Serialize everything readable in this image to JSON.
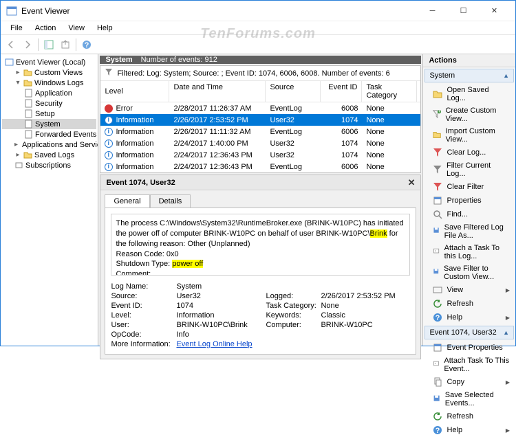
{
  "window": {
    "title": "Event Viewer"
  },
  "menu": [
    "File",
    "Action",
    "View",
    "Help"
  ],
  "watermark": "TenForums.com",
  "tree": {
    "root": "Event Viewer (Local)",
    "custom": "Custom Views",
    "winlogs": "Windows Logs",
    "winlogs_items": [
      "Application",
      "Security",
      "Setup",
      "System",
      "Forwarded Events"
    ],
    "appsvc": "Applications and Services Logs",
    "saved": "Saved Logs",
    "subs": "Subscriptions"
  },
  "midheader": {
    "title": "System",
    "count_label": "Number of events: 912"
  },
  "filterbar": "Filtered: Log: System; Source: ; Event ID: 1074, 6006, 6008. Number of events: 6",
  "columns": {
    "level": "Level",
    "dt": "Date and Time",
    "src": "Source",
    "eid": "Event ID",
    "tc": "Task Category"
  },
  "rows": [
    {
      "lvl": "Error",
      "lvlclass": "lvl-err",
      "dt": "2/28/2017 11:26:37 AM",
      "src": "EventLog",
      "eid": "6008",
      "tc": "None",
      "sel": false
    },
    {
      "lvl": "Information",
      "lvlclass": "lvl-info",
      "dt": "2/26/2017 2:53:52 PM",
      "src": "User32",
      "eid": "1074",
      "tc": "None",
      "sel": true
    },
    {
      "lvl": "Information",
      "lvlclass": "lvl-info",
      "dt": "2/26/2017 11:11:32 AM",
      "src": "EventLog",
      "eid": "6006",
      "tc": "None",
      "sel": false
    },
    {
      "lvl": "Information",
      "lvlclass": "lvl-info",
      "dt": "2/24/2017 1:40:00 PM",
      "src": "User32",
      "eid": "1074",
      "tc": "None",
      "sel": false
    },
    {
      "lvl": "Information",
      "lvlclass": "lvl-info",
      "dt": "2/24/2017 12:36:43 PM",
      "src": "User32",
      "eid": "1074",
      "tc": "None",
      "sel": false
    },
    {
      "lvl": "Information",
      "lvlclass": "lvl-info",
      "dt": "2/24/2017 12:36:43 PM",
      "src": "EventLog",
      "eid": "6006",
      "tc": "None",
      "sel": false
    }
  ],
  "detail": {
    "title": "Event 1074, User32",
    "tab_general": "General",
    "tab_details": "Details",
    "msg_pre": "The process C:\\Windows\\System32\\RuntimeBroker.exe (BRINK-W10PC) has initiated the power off of computer BRINK-W10PC on behalf of user BRINK-W10PC\\",
    "msg_user_hl": "Brink",
    "msg_mid": " for the following reason: Other (Unplanned)",
    "reason_label": "Reason Code: 0x0",
    "shutdown_label": "Shutdown Type: ",
    "shutdown_hl": "power off",
    "comment_label": "Comment:",
    "props": {
      "logname_k": "Log Name:",
      "logname_v": "System",
      "source_k": "Source:",
      "source_v": "User32",
      "logged_k": "Logged:",
      "logged_v": "2/26/2017 2:53:52 PM",
      "eid_k": "Event ID:",
      "eid_v": "1074",
      "tc_k": "Task Category:",
      "tc_v": "None",
      "level_k": "Level:",
      "level_v": "Information",
      "kw_k": "Keywords:",
      "kw_v": "Classic",
      "user_k": "User:",
      "user_v": "BRINK-W10PC\\Brink",
      "comp_k": "Computer:",
      "comp_v": "BRINK-W10PC",
      "op_k": "OpCode:",
      "op_v": "Info",
      "more_k": "More Information:",
      "more_v": "Event Log Online Help"
    }
  },
  "actions": {
    "header": "Actions",
    "group1": "System",
    "g1": [
      "Open Saved Log...",
      "Create Custom View...",
      "Import Custom View...",
      "Clear Log...",
      "Filter Current Log...",
      "Clear Filter",
      "Properties",
      "Find...",
      "Save Filtered Log File As...",
      "Attach a Task To this Log...",
      "Save Filter to Custom View...",
      "View",
      "Refresh",
      "Help"
    ],
    "group2": "Event 1074, User32",
    "g2": [
      "Event Properties",
      "Attach Task To This Event...",
      "Copy",
      "Save Selected Events...",
      "Refresh",
      "Help"
    ]
  }
}
